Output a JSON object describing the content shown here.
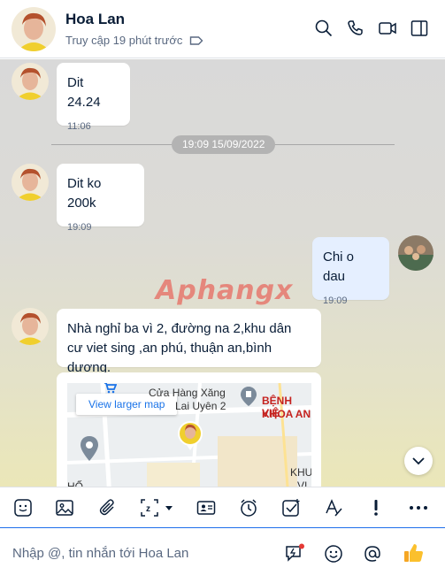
{
  "header": {
    "name": "Hoa Lan",
    "status": "Truy cập 19 phút trước"
  },
  "messages": [
    {
      "text": "Dit 24.24",
      "time": "11:06"
    },
    {
      "text": "Dit ko 200k",
      "time": "19:09"
    },
    {
      "text": "Chi o dau",
      "time": "19:09"
    },
    {
      "text": "Nhà nghỉ ba vì 2, đường na 2,khu dân cư viet sing ,an phú, thuận an,bình dương."
    }
  ],
  "date_divider": "19:09 15/09/2022",
  "watermark": "Aphangx",
  "map": {
    "view_larger": "View larger map",
    "label_gas1": "Cửa Hàng Xăng",
    "label_gas2": "Lai Uyên 2",
    "label_hosp1": "BỆNH VIỆ",
    "label_hosp2": "KHOA AN",
    "label_khu": "KHU",
    "label_v": "VI",
    "label_ho": "HỐ"
  },
  "composer": {
    "placeholder": "Nhập @, tin nhắn tới Hoa Lan"
  },
  "colors": {
    "accent": "#0068ff",
    "my_bubble": "#e5efff"
  }
}
